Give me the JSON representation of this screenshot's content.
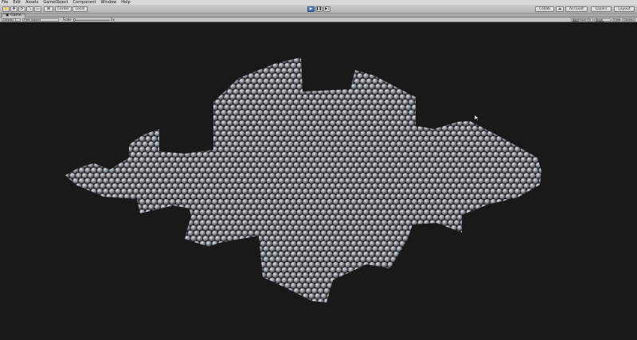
{
  "menu": [
    "File",
    "Edit",
    "Assets",
    "GameObject",
    "Component",
    "Window",
    "Help"
  ],
  "toolbar": {
    "tools": [
      "hand",
      "move",
      "rotate",
      "scale",
      "rect"
    ],
    "pivot_label": "Center",
    "space_label": "Local",
    "play_controls": [
      "play",
      "pause",
      "step"
    ],
    "collab_label": "Collab",
    "account_label": "Account",
    "layers_label": "Layers",
    "layout_label": "Layout"
  },
  "tab": {
    "label": "Game"
  },
  "game_bar": {
    "display_label": "Display 1",
    "aspect_label": "Free Aspect",
    "scale_label": "Scale",
    "scale_value": "1x",
    "maximize_label": "Maximize On Play",
    "mute_label": "Mute Audio",
    "stats_label": "Stats",
    "gizmos_label": "Gizmos"
  },
  "colors": {
    "background": "#191919",
    "sphere_light": "#c4c8cf",
    "sphere_dark": "#4f5258"
  }
}
